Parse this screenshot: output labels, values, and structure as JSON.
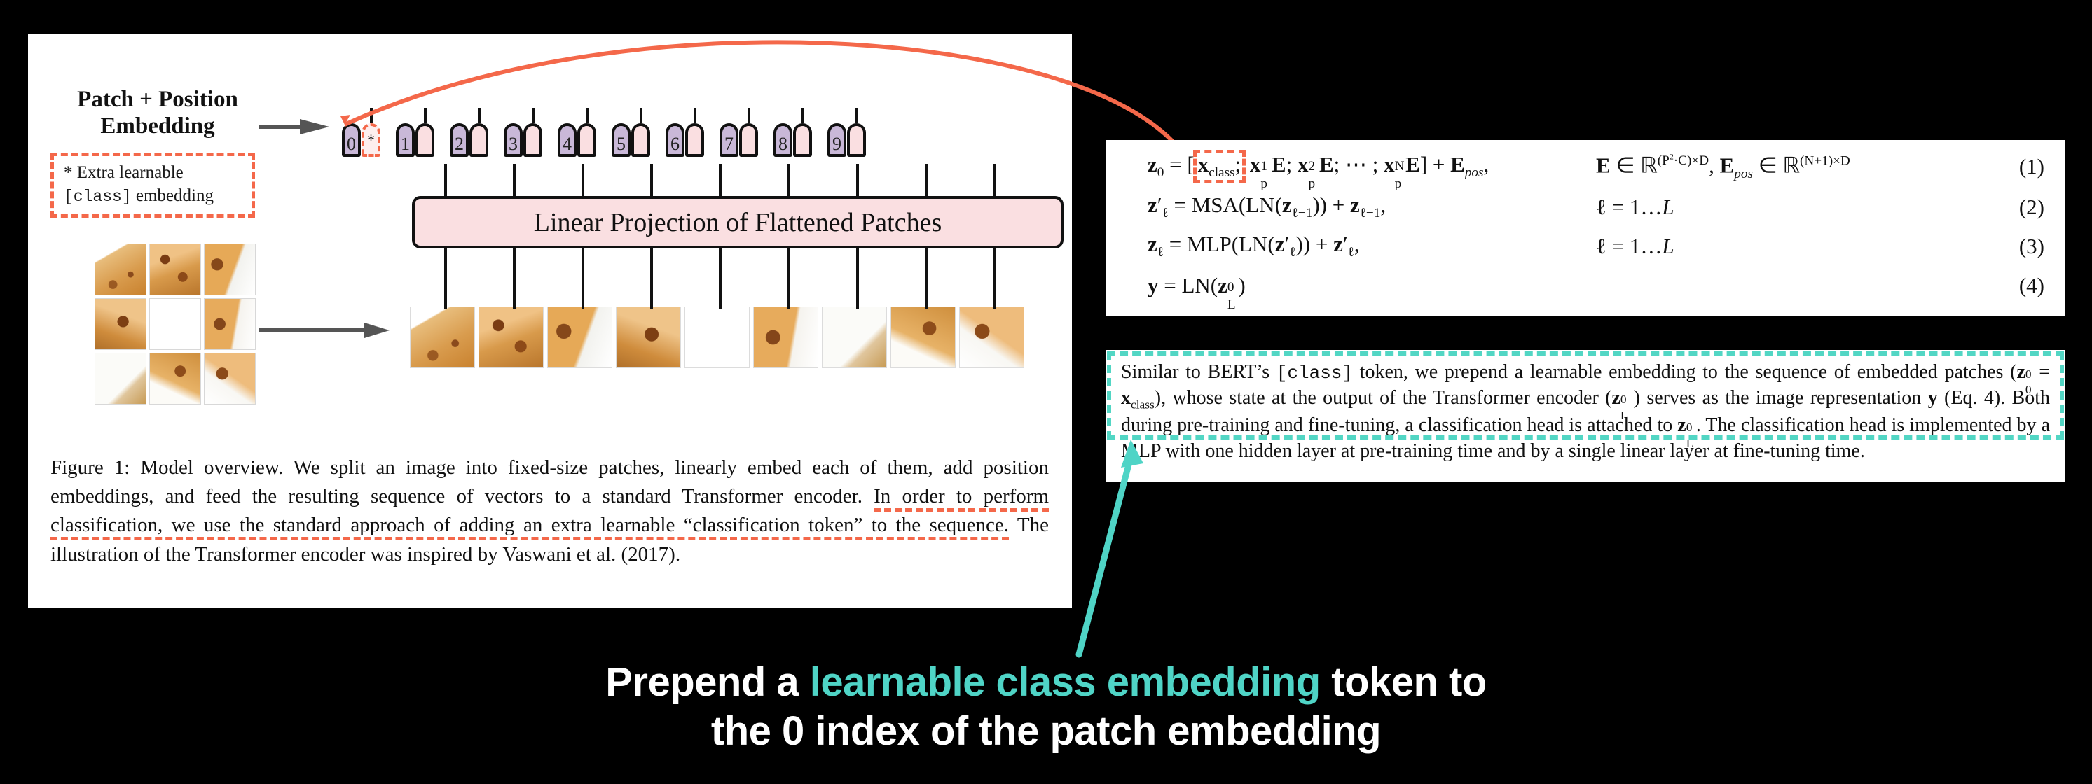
{
  "figure": {
    "patch_position_label": [
      "Patch + Position",
      "Embedding"
    ],
    "extra_learnable_note": {
      "line1": "* Extra learnable",
      "mono": "[class]",
      "line2_rest": " embedding"
    },
    "linear_projection_label": "Linear Projection of Flattened Patches",
    "class_token_mark": "*",
    "token_indices": [
      "0",
      "1",
      "2",
      "3",
      "4",
      "5",
      "6",
      "7",
      "8",
      "9"
    ],
    "caption": {
      "plain_1": "Figure 1: Model overview. We split an image into fixed-size patches, linearly embed each of them, add position embeddings, and feed the resulting sequence of vectors to a standard Transformer encoder. ",
      "highlight_1": "In order to perform classification, we use the standard approach of adding an extra learnable “classification token” to the sequence.",
      "plain_2": " The illustration of the Transformer encoder was inspired by Vaswani et al. (2017)."
    }
  },
  "equations": [
    {
      "lhs_html": "z0 = [xclass; xp1E; xp2E; ⋯ ; xpNE] + Epos,",
      "rhs_html": "E ∈ R(P2·C)×D, Epos ∈ R(N+1)×D",
      "number": "(1)"
    },
    {
      "lhs_html": "z′ℓ = MSA(LN(zℓ−1)) + zℓ−1,",
      "rhs_html": "ℓ = 1…L",
      "number": "(2)"
    },
    {
      "lhs_html": "zℓ = MLP(LN(z′ℓ)) + z′ℓ,",
      "rhs_html": "ℓ = 1…L",
      "number": "(3)"
    },
    {
      "lhs_html": "y = LN(zL0)",
      "rhs_html": "",
      "number": "(4)"
    }
  ],
  "paragraph": {
    "seg_1": "Similar to BERT’s ",
    "mono_1": "[class]",
    "seg_2": " token, we prepend a learnable embedding to the sequence of embedded patches (",
    "seg_3": "), whose state at the output of the Transformer encoder (",
    "seg_4": ") serves as the image representation ",
    "seg_5": " (Eq. 4). Both during pre-training and fine-tuning, a classification head is attached to ",
    "seg_6": ". The classification head is implemented by a MLP with one hidden layer at pre-training time and by a single linear layer at fine-tuning time."
  },
  "bottom_caption": {
    "line1_pre": "Prepend a ",
    "line1_highlight": "learnable class embedding",
    "line1_post": " token to",
    "line2": "the 0 index of the patch embedding"
  },
  "colors": {
    "background": "#000000",
    "panel": "#ffffff",
    "accent_orange": "#f4684a",
    "accent_teal": "#4fd4c6",
    "token_position": "#c9b8d8",
    "token_patch": "#fadfe1"
  }
}
